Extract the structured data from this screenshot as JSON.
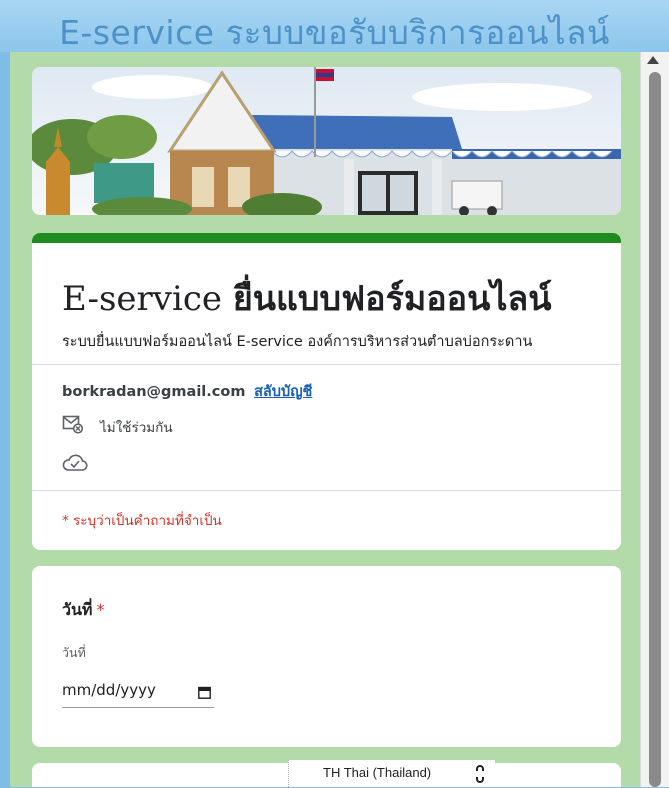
{
  "window": {
    "title": "E-service ระบบขอรับบริการออนไลน์"
  },
  "header": {
    "banner": "office-building-banner-image",
    "title_latin": "E-service",
    "title_thai": "ยื่นแบบฟอร์มออนไลน์",
    "description": "ระบบยื่นแบบฟอร์มออนไลน์ E-service องค์การบริหารส่วนตำบลบ่อกระดาน",
    "accent_color": "#1e8c1e"
  },
  "account": {
    "email": "borkradan@gmail.com",
    "switch_label": "สลับบัญชี",
    "not_shared_label": "ไม่ใช้ร่วมกัน",
    "not_shared_icon": "mail-crossed-icon",
    "cloud_icon": "cloud-check-icon"
  },
  "required_note": "* ระบุว่าเป็นคำถามที่จำเป็น",
  "questions": [
    {
      "label": "วันที่",
      "required_mark": "*",
      "sub_label": "วันที่",
      "placeholder": "mm/dd/yyyy",
      "icon": "calendar-icon"
    }
  ],
  "language_selector": {
    "value": "TH Thai (Thailand)"
  },
  "colors": {
    "page_background": "#b3dbaa",
    "title_color": "#4c92c9",
    "required_color": "#d93025",
    "link_color": "#1a5fb4"
  }
}
